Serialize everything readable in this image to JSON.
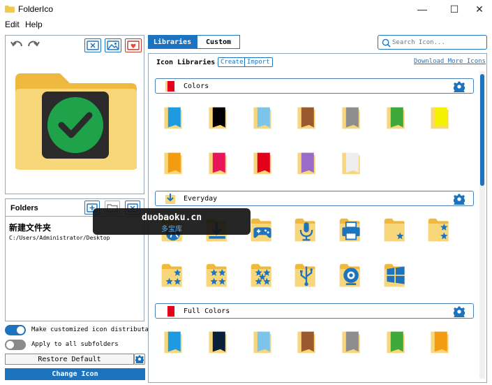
{
  "window": {
    "title": "FolderIco",
    "minimize_glyph": "—",
    "maximize_glyph": "☐",
    "close_glyph": "✕"
  },
  "menu": {
    "items": [
      "Edit",
      "Help"
    ]
  },
  "preview": {
    "undo_icon": "undo-icon",
    "redo_icon": "redo-icon",
    "check_color": "#1fa34a"
  },
  "folders_panel": {
    "title": "Folders",
    "item_name": "新建文件夹",
    "item_path": "C:/Users/Administrator/Desktop"
  },
  "options": {
    "distributable_label": "Make customized icon distributable",
    "distributable_on": true,
    "subfolders_label": "Apply to all subfolders",
    "subfolders_on": false
  },
  "buttons": {
    "restore_default": "Restore Default",
    "change_icon": "Change Icon"
  },
  "tabs": {
    "libraries": "Libraries",
    "custom": "Custom",
    "active": "libraries"
  },
  "search": {
    "placeholder": "Search Icon..."
  },
  "libraries_header": {
    "title": "Icon Libraries",
    "create": "Create",
    "import": "Import",
    "download_more": "Download More Icons"
  },
  "sections": [
    {
      "title": "Colors",
      "rows": [
        [
          "#1e9be0",
          "#000000",
          "#7cc4ea",
          "#9a5a2e",
          "#8e8e8e",
          "#3ea93a",
          "#f5f200"
        ],
        [
          "#f39c12",
          "#e8155a",
          "#e3001b",
          "#9b6bc9",
          "#eeeeee"
        ]
      ]
    },
    {
      "title": "Everyday",
      "rows": [
        [
          "globe-icon",
          "download-icon",
          "gamepad-icon",
          "microphone-icon",
          "printer-icon",
          "star-1-icon",
          "star-2-icon"
        ],
        [
          "star-3-icon",
          "star-4-icon",
          "star-5-icon",
          "usb-icon",
          "webcam-icon",
          "windows-icon"
        ]
      ]
    },
    {
      "title": "Full Colors",
      "rows": [
        [
          "#1e9be0",
          "#0a1f3a",
          "#7cc4ea",
          "#9a5a2e",
          "#8e8e8e",
          "#3ea93a",
          "#f39c12"
        ]
      ]
    }
  ],
  "watermark": {
    "line1": "duobaoku.cn",
    "line2": "多宝库"
  },
  "colors": {
    "accent": "#1e73be",
    "folder_body": "#f8d67a",
    "folder_back": "#efb93f"
  }
}
